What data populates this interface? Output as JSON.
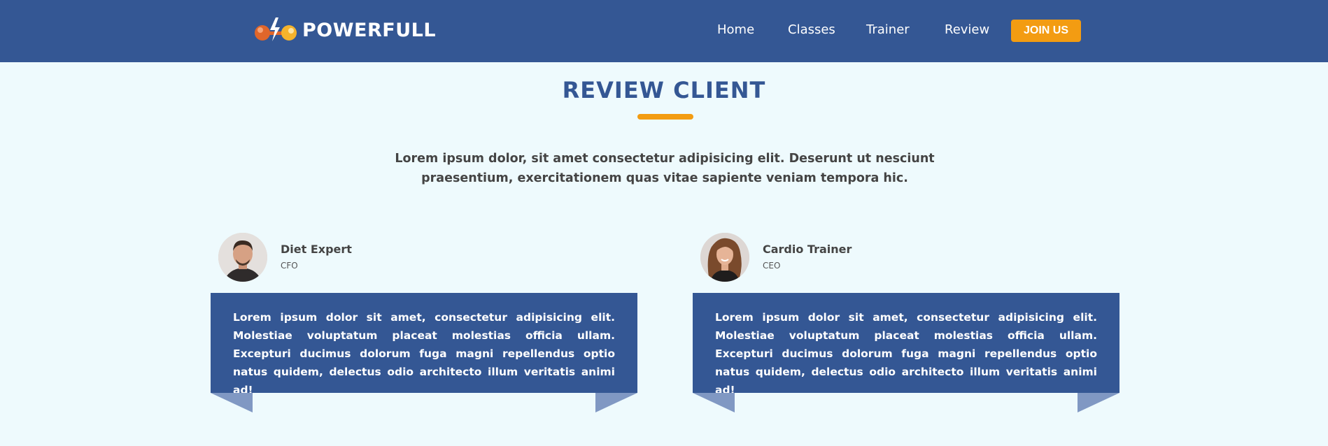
{
  "brand": {
    "name": "POWERFULL",
    "accent": "#f39c12",
    "primary": "#345794"
  },
  "nav": {
    "items": [
      {
        "label": "Home"
      },
      {
        "label": "Classes"
      },
      {
        "label": "Trainer"
      },
      {
        "label": "Review"
      }
    ],
    "cta": "JOIN US"
  },
  "section": {
    "title": "REVIEW CLIENT",
    "intro": "Lorem ipsum dolor, sit amet consectetur adipisicing elit. Deserunt ut nesciunt praesentium, exercitationem quas vitae sapiente veniam tempora hic."
  },
  "reviews": [
    {
      "name": "Diet Expert",
      "role": "CFO",
      "text": "Lorem ipsum dolor sit amet, consectetur adipisicing elit. Molestiae voluptatum placeat molestias officia ullam. Excepturi ducimus dolorum fuga magni repellendus optio natus quidem, delectus odio architecto illum veritatis animi ad!"
    },
    {
      "name": "Cardio Trainer",
      "role": "CEO",
      "text": "Lorem ipsum dolor sit amet, consectetur adipisicing elit. Molestiae voluptatum placeat molestias officia ullam. Excepturi ducimus dolorum fuga magni repellendus optio natus quidem, delectus odio architecto illum veritatis animi ad!"
    }
  ]
}
